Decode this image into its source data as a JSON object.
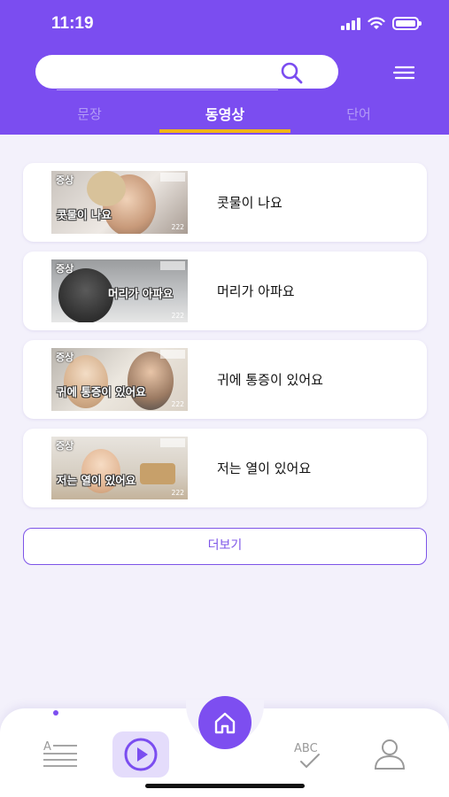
{
  "status_bar": {
    "time": "11:19"
  },
  "search": {
    "value": "",
    "placeholder": ""
  },
  "tabs": [
    {
      "label": "문장",
      "active": false
    },
    {
      "label": "동영상",
      "active": true
    },
    {
      "label": "단어",
      "active": false
    }
  ],
  "videos": [
    {
      "title": "콧물이 나요",
      "thumb_badge": "증상",
      "thumb_caption": "콧물이 나요",
      "thumb_number": "222"
    },
    {
      "title": "머리가 아파요",
      "thumb_badge": "증상",
      "thumb_caption": "머리가 아파요",
      "thumb_number": "222"
    },
    {
      "title": "귀에 통증이 있어요",
      "thumb_badge": "증상",
      "thumb_caption": "귀에 통증이 있어요",
      "thumb_number": "222"
    },
    {
      "title": "저는 열이 있어요",
      "thumb_badge": "증상",
      "thumb_caption": "저는 열이 있어요",
      "thumb_number": "222"
    }
  ],
  "more_button": {
    "label": "더보기"
  },
  "bottom_nav": {
    "items": [
      {
        "icon": "sentence-list-icon",
        "active": false
      },
      {
        "icon": "play-circle-icon",
        "active": true
      },
      {
        "icon": "home-icon",
        "active": false
      },
      {
        "icon": "abc-check-icon",
        "active": false
      },
      {
        "icon": "user-icon",
        "active": false
      }
    ]
  },
  "colors": {
    "primary": "#7b4df0",
    "tab_indicator": "#f2b515",
    "background": "#f3f1fb"
  }
}
